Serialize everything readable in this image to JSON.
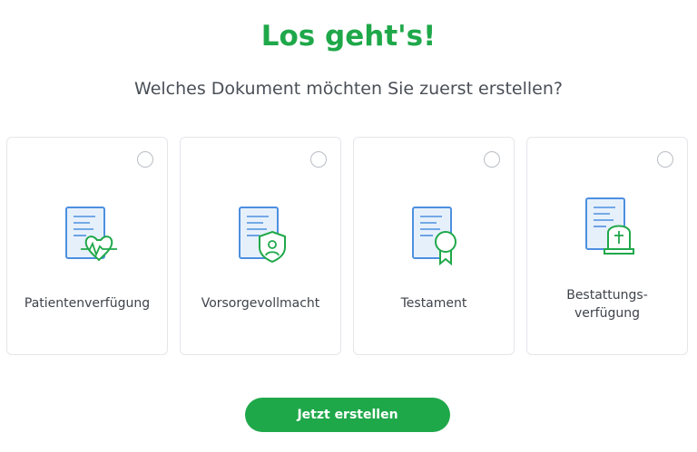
{
  "header": {
    "title": "Los geht's!",
    "subtitle": "Welches Dokument möchten Sie zuerst erstellen?"
  },
  "documents": [
    {
      "label": "Patientenverfügung",
      "icon": "document-heart-icon",
      "selected": false
    },
    {
      "label": "Vorsorgevollmacht",
      "icon": "document-shield-icon",
      "selected": false
    },
    {
      "label": "Testament",
      "icon": "document-certificate-icon",
      "selected": false
    },
    {
      "label_line1": "Bestattungs-",
      "label_line2": "verfügung",
      "icon": "document-gravestone-icon",
      "selected": false
    }
  ],
  "cta": {
    "label": "Jetzt erstellen"
  },
  "colors": {
    "accent": "#1fa84a",
    "icon_blue": "#4d8fe0",
    "icon_fill": "#e6f0fb"
  }
}
